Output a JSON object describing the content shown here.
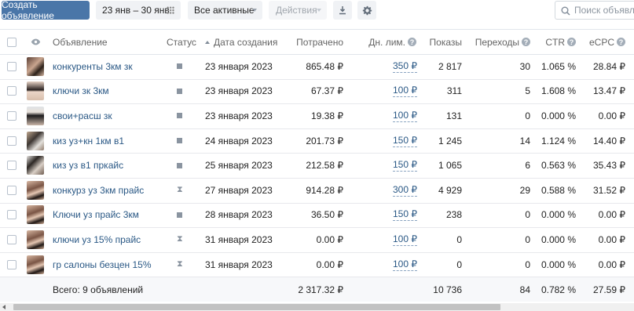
{
  "toolbar": {
    "create_button": "Создать объявление",
    "date_range": "23 янв – 30 янв",
    "status_filter": "Все активные",
    "actions": "Действия",
    "search_placeholder": "Поиск объявлен"
  },
  "columns": {
    "ad": "Объявление",
    "status": "Статус",
    "created": "Дата создания",
    "spent": "Потрачено",
    "daily_limit": "Дн. лим.",
    "impressions": "Показы",
    "clicks": "Переходы",
    "ctr": "CTR",
    "ecpc": "eCPC"
  },
  "rows": [
    {
      "name": "конкуренты 3км зк",
      "status": "stopped",
      "date": "23 января 2023",
      "spent": "865.48 ₽",
      "limit": "350 ₽",
      "impressions": "2 817",
      "clicks": "30",
      "ctr": "1.065 %",
      "ecpc": "28.84 ₽"
    },
    {
      "name": "ключи зк 3км",
      "status": "stopped",
      "date": "23 января 2023",
      "spent": "67.37 ₽",
      "limit": "100 ₽",
      "impressions": "311",
      "clicks": "5",
      "ctr": "1.608 %",
      "ecpc": "13.47 ₽"
    },
    {
      "name": "свои+расш зк",
      "status": "stopped",
      "date": "23 января 2023",
      "spent": "19.38 ₽",
      "limit": "100 ₽",
      "impressions": "131",
      "clicks": "0",
      "ctr": "0.000 %",
      "ecpc": "0.00 ₽"
    },
    {
      "name": "киз уз+кн 1км в1",
      "status": "stopped",
      "date": "24 января 2023",
      "spent": "201.73 ₽",
      "limit": "150 ₽",
      "impressions": "1 245",
      "clicks": "14",
      "ctr": "1.124 %",
      "ecpc": "14.40 ₽"
    },
    {
      "name": "киз уз в1 пркайс",
      "status": "stopped",
      "date": "25 января 2023",
      "spent": "212.58 ₽",
      "limit": "150 ₽",
      "impressions": "1 065",
      "clicks": "6",
      "ctr": "0.563 %",
      "ecpc": "35.43 ₽"
    },
    {
      "name": "конкурз уз 3км прайс",
      "status": "pending",
      "date": "27 января 2023",
      "spent": "914.28 ₽",
      "limit": "300 ₽",
      "impressions": "4 929",
      "clicks": "29",
      "ctr": "0.588 %",
      "ecpc": "31.52 ₽"
    },
    {
      "name": "Ключи уз прайс 3км",
      "status": "stopped",
      "date": "28 января 2023",
      "spent": "36.50 ₽",
      "limit": "150 ₽",
      "impressions": "238",
      "clicks": "0",
      "ctr": "0.000 %",
      "ecpc": "0.00 ₽"
    },
    {
      "name": "ключи уз 15% прайс",
      "status": "pending",
      "date": "31 января 2023",
      "spent": "0.00 ₽",
      "limit": "100 ₽",
      "impressions": "0",
      "clicks": "0",
      "ctr": "0.000 %",
      "ecpc": "0.00 ₽"
    },
    {
      "name": "гр салоны безцен 15%",
      "status": "pending",
      "date": "31 января 2023",
      "spent": "0.00 ₽",
      "limit": "100 ₽",
      "impressions": "0",
      "clicks": "0",
      "ctr": "0.000 %",
      "ecpc": "0.00 ₽"
    }
  ],
  "totals": {
    "label": "Всего: 9 объявлений",
    "spent": "2 317.32 ₽",
    "impressions": "10 736",
    "clicks": "84",
    "ctr": "0.782 %",
    "ecpc": "27.59 ₽"
  },
  "icons": {
    "status_stopped": "square-icon",
    "status_pending": "hourglass-icon",
    "visibility": "eye-icon",
    "help": "question-icon"
  },
  "colors": {
    "primary": "#4a76a8",
    "link": "#2a5885"
  }
}
